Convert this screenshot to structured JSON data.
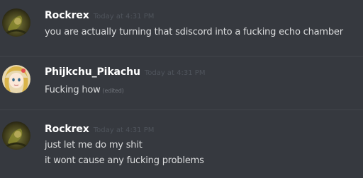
{
  "messages": [
    {
      "author": "Rockrex",
      "timestamp": "Today at 4:31 PM",
      "lines": [
        "you are actually turning that sdiscord into a fucking echo chamber"
      ]
    },
    {
      "author": "Phijkchu_Pikachu",
      "timestamp": "Today at 4:31 PM",
      "lines": [
        "Fucking how"
      ],
      "edited_label": "(edited)"
    },
    {
      "author": "Rockrex",
      "timestamp": "Today at 4:31 PM",
      "lines": [
        "just let me do my shit",
        "it wont cause any fucking problems"
      ]
    }
  ],
  "colors": {
    "background": "#36393f",
    "username": "#ffffff",
    "message_text": "#dcddde",
    "timestamp": "#4f545c",
    "divider": "#42454a"
  }
}
